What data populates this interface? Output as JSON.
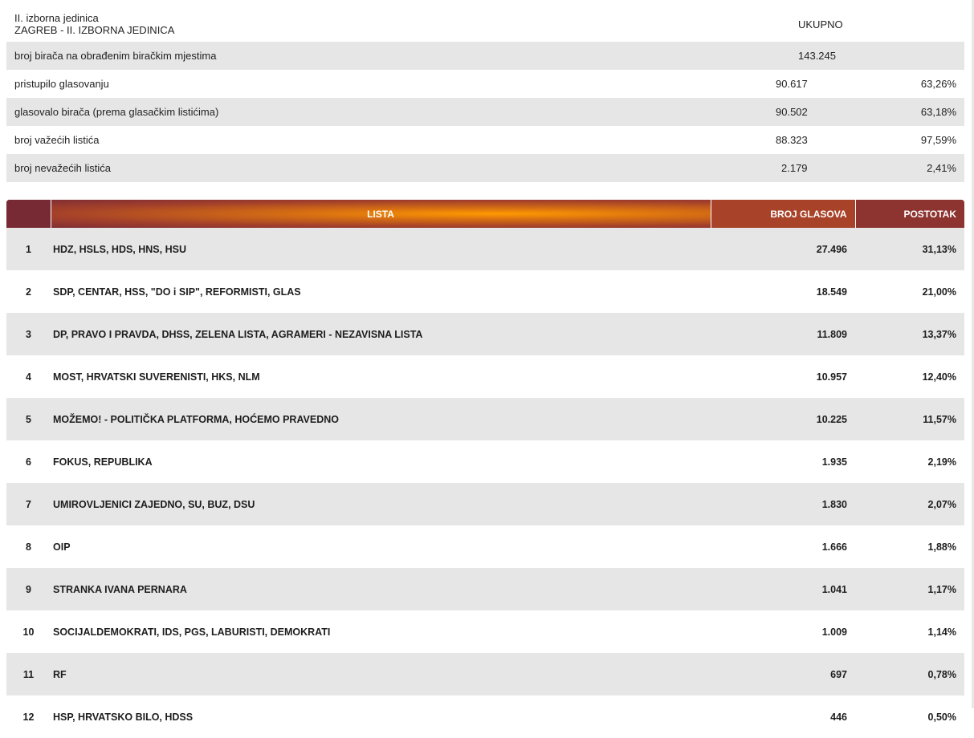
{
  "header": {
    "unit_line1": "II. izborna jedinica",
    "unit_line2": "ZAGREB - II. IZBORNA JEDINICA",
    "total_label": "UKUPNO"
  },
  "summary": [
    {
      "label": "broj birača na obrađenim biračkim mjestima",
      "value": "143.245",
      "pct": ""
    },
    {
      "label": "pristupilo glasovanju",
      "value": "90.617",
      "pct": "63,26%"
    },
    {
      "label": "glasovalo birača (prema glasačkim listićima)",
      "value": "90.502",
      "pct": "63,18%"
    },
    {
      "label": "broj važećih listića",
      "value": "88.323",
      "pct": "97,59%"
    },
    {
      "label": "broj nevažećih listića",
      "value": "2.179",
      "pct": "2,41%"
    }
  ],
  "results_header": {
    "list": "LISTA",
    "votes": "BROJ GLASOVA",
    "pct": "POSTOTAK"
  },
  "results": [
    {
      "rank": "1",
      "list": "HDZ, HSLS, HDS, HNS, HSU",
      "votes": "27.496",
      "pct": "31,13%"
    },
    {
      "rank": "2",
      "list": "SDP, CENTAR, HSS, \"DO i SIP\", REFORMISTI, GLAS",
      "votes": "18.549",
      "pct": "21,00%"
    },
    {
      "rank": "3",
      "list": "DP, PRAVO I PRAVDA, DHSS, ZELENA LISTA, AGRAMERI - NEZAVISNA LISTA",
      "votes": "11.809",
      "pct": "13,37%"
    },
    {
      "rank": "4",
      "list": "MOST, HRVATSKI SUVERENISTI, HKS, NLM",
      "votes": "10.957",
      "pct": "12,40%"
    },
    {
      "rank": "5",
      "list": "MOŽEMO! - POLITIČKA PLATFORMA, HOĆEMO PRAVEDNO",
      "votes": "10.225",
      "pct": "11,57%"
    },
    {
      "rank": "6",
      "list": "FOKUS, REPUBLIKA",
      "votes": "1.935",
      "pct": "2,19%"
    },
    {
      "rank": "7",
      "list": "UMIROVLJENICI ZAJEDNO, SU, BUZ, DSU",
      "votes": "1.830",
      "pct": "2,07%"
    },
    {
      "rank": "8",
      "list": "OIP",
      "votes": "1.666",
      "pct": "1,88%"
    },
    {
      "rank": "9",
      "list": "STRANKA IVANA PERNARA",
      "votes": "1.041",
      "pct": "1,17%"
    },
    {
      "rank": "10",
      "list": "SOCIJALDEMOKRATI, IDS, PGS, LABURISTI, DEMOKRATI",
      "votes": "1.009",
      "pct": "1,14%"
    },
    {
      "rank": "11",
      "list": "RF",
      "votes": "697",
      "pct": "0,78%"
    },
    {
      "rank": "12",
      "list": "HSP, HRVATSKO BILO, HDSS",
      "votes": "446",
      "pct": "0,50%"
    }
  ],
  "colors": {
    "header_center": "#ff9a00",
    "header_edge": "#7b2b36",
    "row_alt": "#e6e6e6"
  }
}
